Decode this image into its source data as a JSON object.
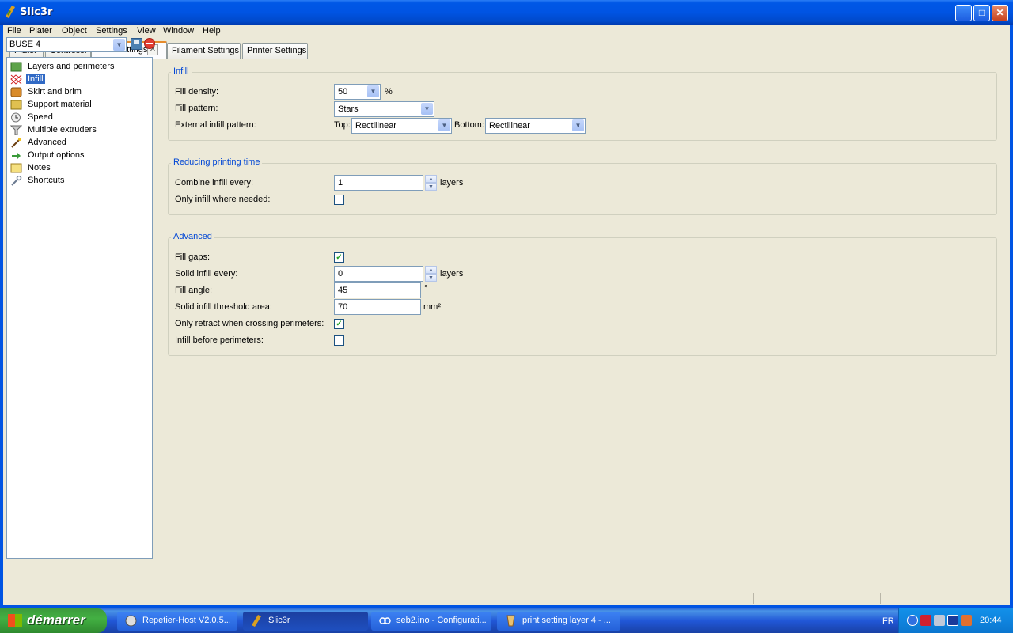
{
  "window": {
    "title": "Slic3r",
    "controls": {
      "minimize": "_",
      "maximize": "□",
      "close": "✕"
    }
  },
  "menu": [
    "File",
    "Plater",
    "Object",
    "Settings",
    "View",
    "Window",
    "Help"
  ],
  "tabs": [
    {
      "label": "Plater"
    },
    {
      "label": "Controller"
    },
    {
      "label": "Print Settings"
    },
    {
      "label": "Filament Settings"
    },
    {
      "label": "Printer Settings"
    }
  ],
  "preset": {
    "value": "BUSE 4"
  },
  "tree": [
    {
      "label": "Layers and perimeters",
      "icon": "layers-icon"
    },
    {
      "label": "Infill",
      "icon": "infill-icon",
      "selected": true
    },
    {
      "label": "Skirt and brim",
      "icon": "brim-icon"
    },
    {
      "label": "Support material",
      "icon": "support-icon"
    },
    {
      "label": "Speed",
      "icon": "clock-icon"
    },
    {
      "label": "Multiple extruders",
      "icon": "funnel-icon"
    },
    {
      "label": "Advanced",
      "icon": "wand-icon"
    },
    {
      "label": "Output options",
      "icon": "output-icon"
    },
    {
      "label": "Notes",
      "icon": "note-icon"
    },
    {
      "label": "Shortcuts",
      "icon": "wrench-icon"
    }
  ],
  "infill": {
    "title": "Infill",
    "fill_density_label": "Fill density:",
    "fill_density": "50",
    "fill_density_unit": "%",
    "fill_pattern_label": "Fill pattern:",
    "fill_pattern": "Stars",
    "external_label": "External infill pattern:",
    "top_label": "Top:",
    "top_value": "Rectilinear",
    "bottom_label": "Bottom:",
    "bottom_value": "Rectilinear"
  },
  "reducing": {
    "title": "Reducing printing time",
    "combine_label": "Combine infill every:",
    "combine_value": "1",
    "combine_unit": "layers",
    "only_needed_label": "Only infill where needed:",
    "only_needed": false
  },
  "advanced": {
    "title": "Advanced",
    "fill_gaps_label": "Fill gaps:",
    "fill_gaps": true,
    "solid_every_label": "Solid infill every:",
    "solid_every": "0",
    "solid_every_unit": "layers",
    "fill_angle_label": "Fill angle:",
    "fill_angle": "45",
    "fill_angle_unit": "°",
    "threshold_label": "Solid infill threshold area:",
    "threshold": "70",
    "threshold_unit": "mm²",
    "retract_label": "Only retract when crossing perimeters:",
    "retract": true,
    "before_label": "Infill before perimeters:",
    "before": false
  },
  "taskbar": {
    "start": "démarrer",
    "items": [
      {
        "label": "Repetier-Host V2.0.5...",
        "icon": "repetier-icon"
      },
      {
        "label": "Slic3r",
        "icon": "slic3r-icon",
        "active": true
      },
      {
        "label": "seb2.ino - Configurati...",
        "icon": "arduino-icon"
      },
      {
        "label": "print setting layer 4 - ...",
        "icon": "paint-icon"
      }
    ],
    "lang": "FR",
    "time": "20:44"
  },
  "colors": {
    "titlebar": "#0054e3",
    "taskbar": "#245edb",
    "start": "#3c9a3c",
    "selection": "#316ac5",
    "group_title": "#0046d5",
    "window_bg": "#ece9d8"
  }
}
